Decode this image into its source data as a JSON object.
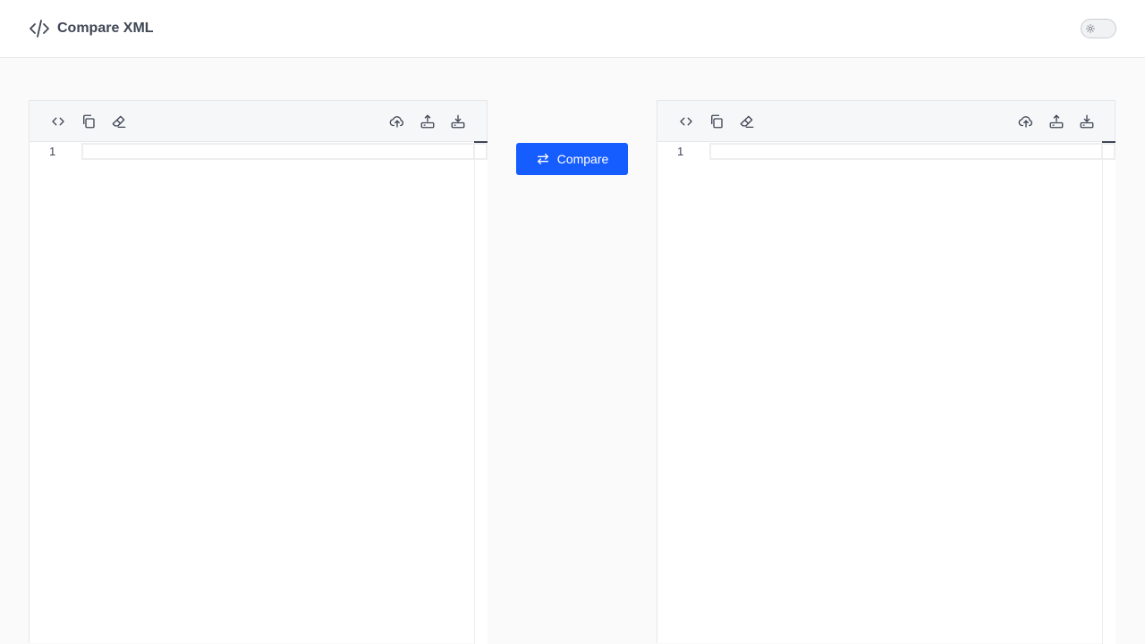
{
  "header": {
    "title": "Compare XML",
    "logo_icon": "code-slash-icon",
    "theme_toggle_icon": "sun-icon"
  },
  "compare_button": {
    "label": "Compare",
    "icon": "swap-arrows-icon",
    "color": "#165dff"
  },
  "editors": [
    {
      "id": "left",
      "line_numbers": [
        "1"
      ],
      "toolbar_left": [
        "format-code-icon",
        "copy-icon",
        "eraser-icon"
      ],
      "toolbar_right": [
        "cloud-upload-icon",
        "upload-icon",
        "download-icon"
      ]
    },
    {
      "id": "right",
      "line_numbers": [
        "1"
      ],
      "toolbar_left": [
        "format-code-icon",
        "copy-icon",
        "eraser-icon"
      ],
      "toolbar_right": [
        "cloud-upload-icon",
        "upload-icon",
        "download-icon"
      ]
    }
  ]
}
